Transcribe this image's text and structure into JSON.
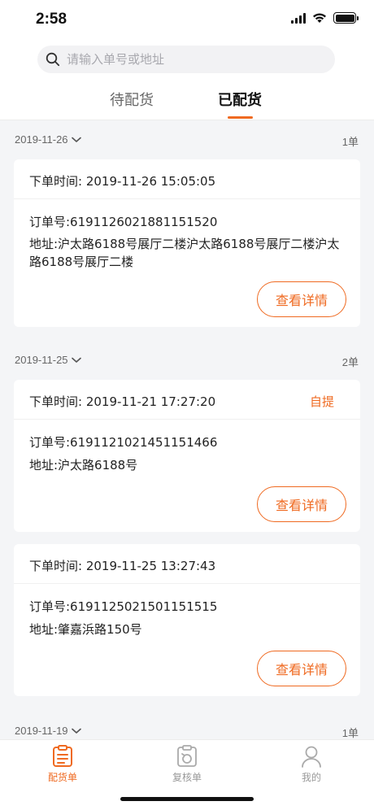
{
  "status": {
    "time": "2:58"
  },
  "search": {
    "placeholder": "请输入单号或地址"
  },
  "tabs": [
    {
      "label": "待配货",
      "active": false
    },
    {
      "label": "已配货",
      "active": true
    }
  ],
  "groups": [
    {
      "date": "2019-11-26",
      "count": "1单",
      "orders": [
        {
          "time_label": "下单时间: 2019-11-26 15:05:05",
          "pickup": "",
          "order_no": "订单号:6191126021881151520",
          "address": "地址:沪太路6188号展厅二楼沪太路6188号展厅二楼沪太路6188号展厅二楼",
          "button": "查看详情"
        }
      ]
    },
    {
      "date": "2019-11-25",
      "count": "2单",
      "orders": [
        {
          "time_label": "下单时间: 2019-11-21 17:27:20",
          "pickup": "自提",
          "order_no": "订单号:6191121021451151466",
          "address": "地址:沪太路6188号",
          "button": "查看详情"
        },
        {
          "time_label": "下单时间: 2019-11-25 13:27:43",
          "pickup": "",
          "order_no": "订单号:6191125021501151515",
          "address": "地址:肇嘉浜路150号",
          "button": "查看详情"
        }
      ]
    },
    {
      "date": "2019-11-19",
      "count": "1单",
      "orders": []
    }
  ],
  "tabbar": [
    {
      "label": "配货单",
      "icon": "clipboard-list-icon",
      "active": true
    },
    {
      "label": "复核单",
      "icon": "clipboard-refresh-icon",
      "active": false
    },
    {
      "label": "我的",
      "icon": "user-icon",
      "active": false
    }
  ],
  "colors": {
    "accent": "#ef6a21",
    "background": "#f4f5f7"
  }
}
